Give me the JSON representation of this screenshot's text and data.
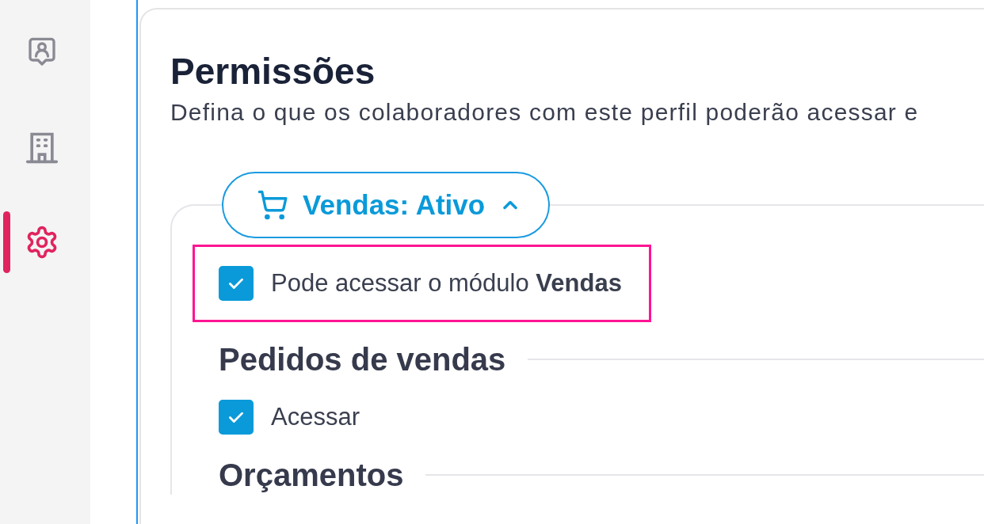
{
  "sidebar": {
    "items": [
      {
        "kind": "contact",
        "selected": false
      },
      {
        "kind": "building",
        "selected": false
      },
      {
        "kind": "settings",
        "selected": true
      }
    ]
  },
  "page": {
    "title": "Permissões",
    "subtitle": "Defina o que os colaboradores com este perfil poderão acessar e"
  },
  "module": {
    "label": "Vendas: Ativo",
    "expanded": true,
    "access": {
      "label": "Pode acessar o módulo **Vendas**",
      "checked": true,
      "highlighted": true
    },
    "sections": [
      {
        "title": "Pedidos de vendas",
        "permissions": [
          {
            "label": "Acessar",
            "checked": true
          }
        ]
      },
      {
        "title": "Orçamentos"
      }
    ]
  }
}
